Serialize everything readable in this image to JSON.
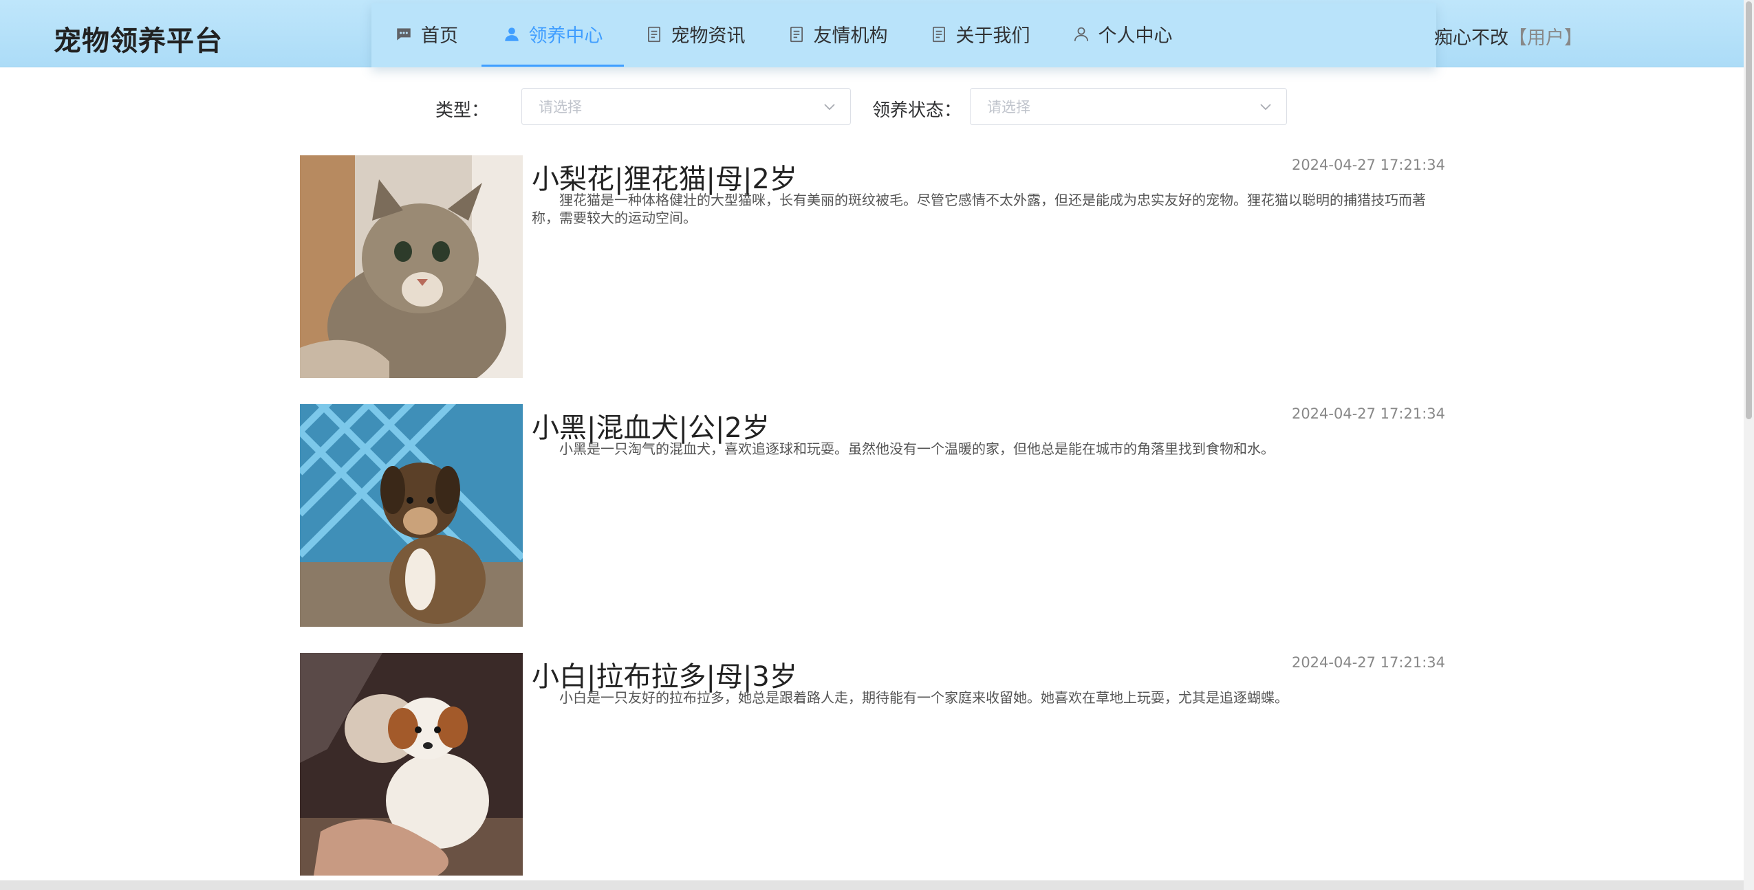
{
  "header": {
    "brand": "宠物领养平台",
    "nav": [
      {
        "label": "首页",
        "icon": "chat-icon"
      },
      {
        "label": "领养中心",
        "icon": "user-icon"
      },
      {
        "label": "宠物资讯",
        "icon": "document-icon"
      },
      {
        "label": "友情机构",
        "icon": "document-icon"
      },
      {
        "label": "关于我们",
        "icon": "document-icon"
      },
      {
        "label": "个人中心",
        "icon": "user-outline-icon"
      }
    ],
    "active_nav": "领养中心",
    "user": {
      "name": "痴心不改",
      "role": "【用户】"
    }
  },
  "filters": {
    "type_label": "类型：",
    "type_placeholder": "请选择",
    "status_label": "领养状态：",
    "status_placeholder": "请选择"
  },
  "pets": [
    {
      "title": "小梨花|狸花猫|母|2岁",
      "time": "2024-04-27 17:21:34",
      "desc": "狸花猫是一种体格健壮的大型猫咪，长有美丽的斑纹被毛。尽管它感情不太外露，但还是能成为忠实友好的宠物。狸花猫以聪明的捕猎技巧而著称，需要较大的运动空间。"
    },
    {
      "title": "小黑|混血犬|公|2岁",
      "time": "2024-04-27 17:21:34",
      "desc": "小黑是一只淘气的混血犬，喜欢追逐球和玩耍。虽然他没有一个温暖的家，但他总是能在城市的角落里找到食物和水。"
    },
    {
      "title": "小白|拉布拉多|母|3岁",
      "time": "2024-04-27 17:21:34",
      "desc": "小白是一只友好的拉布拉多，她总是跟着路人走，期待能有一个家庭来收留她。她喜欢在草地上玩耍，尤其是追逐蝴蝶。"
    }
  ]
}
